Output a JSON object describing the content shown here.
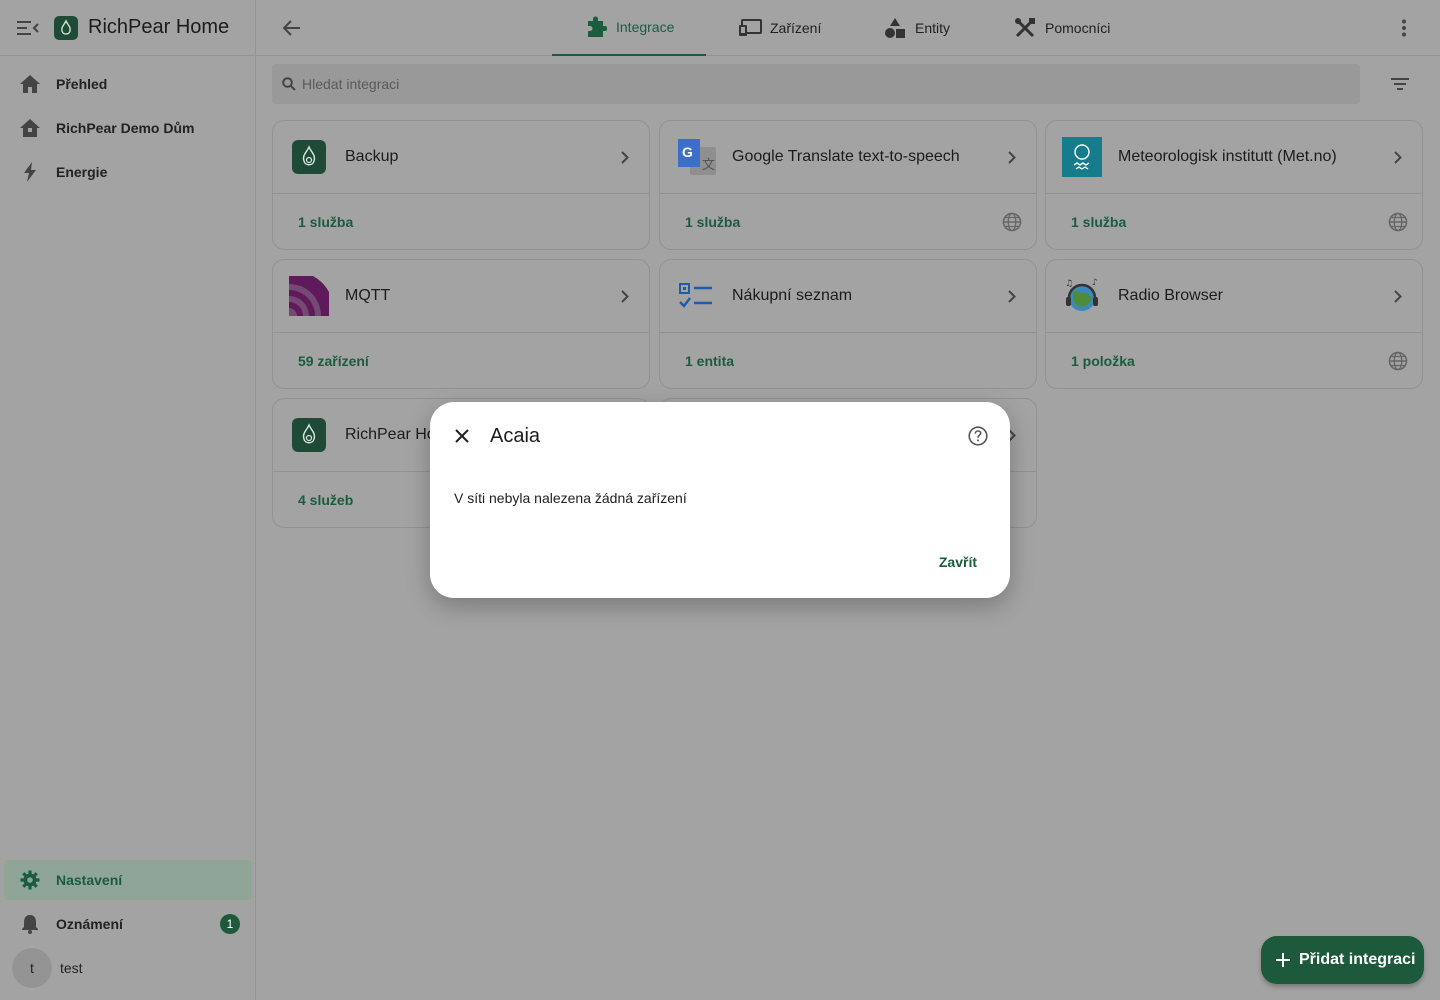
{
  "app": {
    "title": "RichPear Home"
  },
  "sidebar": {
    "items": [
      {
        "label": "Přehled",
        "icon": "home-icon"
      },
      {
        "label": "RichPear Demo Dům",
        "icon": "home-variant-icon"
      },
      {
        "label": "Energie",
        "icon": "lightning-icon"
      }
    ],
    "bottom": {
      "settings": "Nastavení",
      "notifications": "Oznámení",
      "notifications_count": "1",
      "user_initial": "t",
      "user_name": "test"
    }
  },
  "tabs": [
    {
      "label": "Integrace",
      "icon": "puzzle-icon",
      "active": true
    },
    {
      "label": "Zařízení",
      "icon": "devices-icon",
      "active": false
    },
    {
      "label": "Entity",
      "icon": "shapes-icon",
      "active": false
    },
    {
      "label": "Pomocníci",
      "icon": "tools-icon",
      "active": false
    }
  ],
  "search": {
    "placeholder": "Hledat integraci"
  },
  "cards": [
    {
      "name": "Backup",
      "link": "1 služba",
      "cloud": false
    },
    {
      "name": "Google Translate text-to-speech",
      "link": "1 služba",
      "cloud": true
    },
    {
      "name": "Meteorologisk institutt (Met.no)",
      "link": "1 služba",
      "cloud": true
    },
    {
      "name": "MQTT",
      "link": "59 zařízení",
      "cloud": false
    },
    {
      "name": "Nákupní seznam",
      "link": "1 entita",
      "cloud": false
    },
    {
      "name": "Radio Browser",
      "link": "1 položka",
      "cloud": true
    },
    {
      "name": "RichPear Ho",
      "link": "4 služeb",
      "cloud": false
    }
  ],
  "fab": {
    "label": "Přidat integraci"
  },
  "dialog": {
    "title": "Acaia",
    "message": "V síti nebyla nalezena žádná zařízení",
    "close_button": "Zavřít"
  },
  "colors": {
    "accent": "#1a5c3e",
    "scrim_background": "#a3a3a3",
    "dialog_background": "#ffffff"
  }
}
